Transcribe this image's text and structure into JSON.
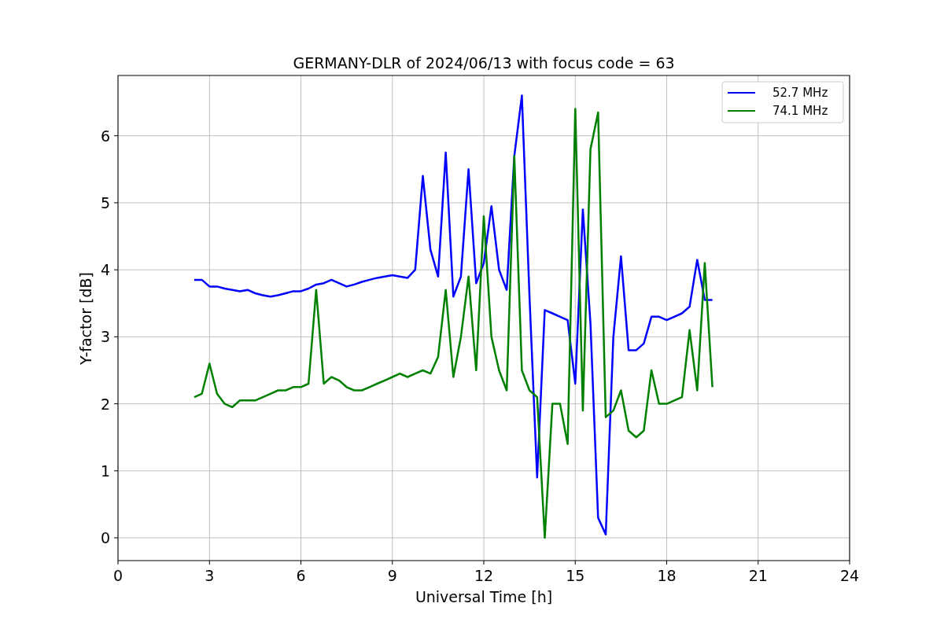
{
  "figure": {
    "chart_data": {
      "type": "line",
      "title": "GERMANY-DLR of 2024/06/13 with focus code = 63",
      "xlabel": "Universal Time [h]",
      "ylabel": "Y-factor [dB]",
      "xlim": [
        0,
        24
      ],
      "ylim": [
        -0.34,
        6.9
      ],
      "xticks": [
        0,
        3,
        6,
        9,
        12,
        15,
        18,
        21,
        24
      ],
      "yticks": [
        0,
        1,
        2,
        3,
        4,
        5,
        6
      ],
      "grid": true,
      "legend": "upper right",
      "x": [
        2.5,
        2.75,
        3,
        3.25,
        3.5,
        3.75,
        4,
        4.25,
        4.5,
        4.75,
        5,
        5.25,
        5.5,
        5.75,
        6,
        6.25,
        6.5,
        6.75,
        7,
        7.25,
        7.5,
        7.75,
        8,
        8.25,
        8.5,
        8.75,
        9,
        9.25,
        9.5,
        9.75,
        10,
        10.25,
        10.5,
        10.75,
        11,
        11.25,
        11.5,
        11.75,
        12,
        12.25,
        12.5,
        12.75,
        13,
        13.25,
        13.5,
        13.75,
        14,
        14.25,
        14.5,
        14.75,
        15,
        15.25,
        15.5,
        15.75,
        16,
        16.25,
        16.5,
        16.75,
        17,
        17.25,
        17.5,
        17.75,
        18,
        18.25,
        18.5,
        18.75,
        19,
        19.25,
        19.5
      ],
      "series": [
        {
          "name": "52.7 MHz",
          "color": "#0000ff",
          "values": [
            3.85,
            3.85,
            3.75,
            3.75,
            3.72,
            3.7,
            3.68,
            3.7,
            3.65,
            3.62,
            3.6,
            3.62,
            3.65,
            3.68,
            3.68,
            3.72,
            3.78,
            3.8,
            3.85,
            3.8,
            3.75,
            3.78,
            3.82,
            3.85,
            3.88,
            3.9,
            3.92,
            3.9,
            3.88,
            4.0,
            5.4,
            4.3,
            3.9,
            5.75,
            3.6,
            3.9,
            5.5,
            3.8,
            4.1,
            4.95,
            4.0,
            3.7,
            5.7,
            6.6,
            3.6,
            0.9,
            3.4,
            3.35,
            3.3,
            3.25,
            2.3,
            4.9,
            3.2,
            0.3,
            0.05,
            3.0,
            4.2,
            2.8,
            2.8,
            2.9,
            3.3,
            3.3,
            3.25,
            3.3,
            3.35,
            3.45,
            4.15,
            3.55,
            3.55
          ]
        },
        {
          "name": "74.1 MHz",
          "color": "#008000",
          "values": [
            2.1,
            2.15,
            2.6,
            2.15,
            2.0,
            1.95,
            2.05,
            2.05,
            2.05,
            2.1,
            2.15,
            2.2,
            2.2,
            2.25,
            2.25,
            2.3,
            3.7,
            2.3,
            2.4,
            2.35,
            2.25,
            2.2,
            2.2,
            2.25,
            2.3,
            2.35,
            2.4,
            2.45,
            2.4,
            2.45,
            2.5,
            2.45,
            2.7,
            3.7,
            2.4,
            3.0,
            3.9,
            2.5,
            4.8,
            3.0,
            2.5,
            2.2,
            5.7,
            2.5,
            2.2,
            2.1,
            0.0,
            2.0,
            2.0,
            1.4,
            6.4,
            1.9,
            5.8,
            6.35,
            1.8,
            1.9,
            2.2,
            1.6,
            1.5,
            1.6,
            2.5,
            2.0,
            2.0,
            2.05,
            2.1,
            3.1,
            2.2,
            4.1,
            2.25
          ]
        }
      ]
    }
  }
}
